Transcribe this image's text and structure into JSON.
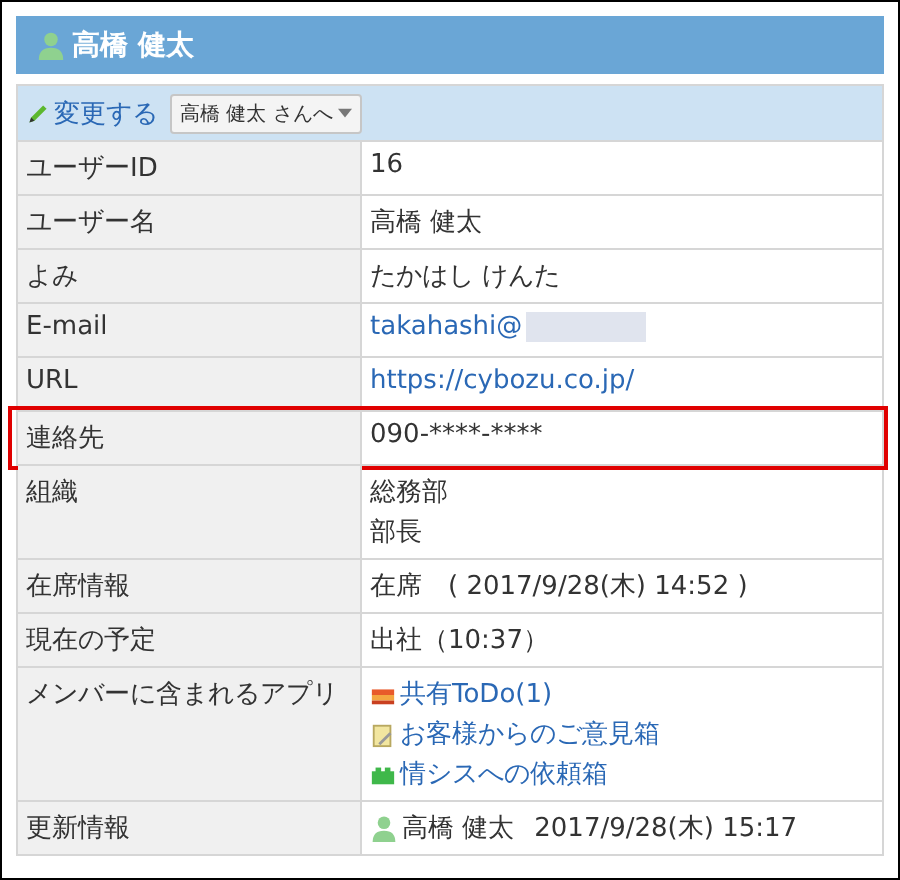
{
  "header": {
    "title": "高橋 健太"
  },
  "toolbar": {
    "edit_link": "変更する",
    "menu_button": "高橋 健太 さんへ"
  },
  "rows": [
    {
      "label": "ユーザーID",
      "kind": "text",
      "lines": [
        "16"
      ],
      "highlighted": false
    },
    {
      "label": "ユーザー名",
      "kind": "text",
      "lines": [
        "高橋 健太"
      ],
      "highlighted": false
    },
    {
      "label": "よみ",
      "kind": "text",
      "lines": [
        "たかはし けんた"
      ],
      "highlighted": false
    },
    {
      "label": "E-mail",
      "kind": "link",
      "lines": [
        "takahashi@"
      ],
      "redacted": true,
      "highlighted": false
    },
    {
      "label": "URL",
      "kind": "link",
      "lines": [
        "https://cybozu.co.jp/"
      ],
      "redacted": false,
      "highlighted": false
    },
    {
      "label": "連絡先",
      "kind": "text",
      "lines": [
        "090-****-****"
      ],
      "highlighted": true
    },
    {
      "label": "組織",
      "kind": "text",
      "lines": [
        "総務部",
        "部長"
      ],
      "highlighted": false
    },
    {
      "label": "在席情報",
      "kind": "text",
      "lines": [
        "在席　( 2017/9/28(木) 14:52 )"
      ],
      "highlighted": false
    },
    {
      "label": "現在の予定",
      "kind": "text",
      "lines": [
        "出社（10:37）"
      ],
      "highlighted": false
    },
    {
      "label": "メンバーに含まれるアプリ",
      "kind": "apps",
      "lines": [
        "共有ToDo(1)",
        "お客様からのご意見箱",
        "情シスへの依頼箱"
      ],
      "highlighted": false
    },
    {
      "label": "更新情報",
      "kind": "user",
      "lines": [
        "高橋 健太",
        "2017/9/28(木) 15:17"
      ],
      "highlighted": false
    }
  ]
}
